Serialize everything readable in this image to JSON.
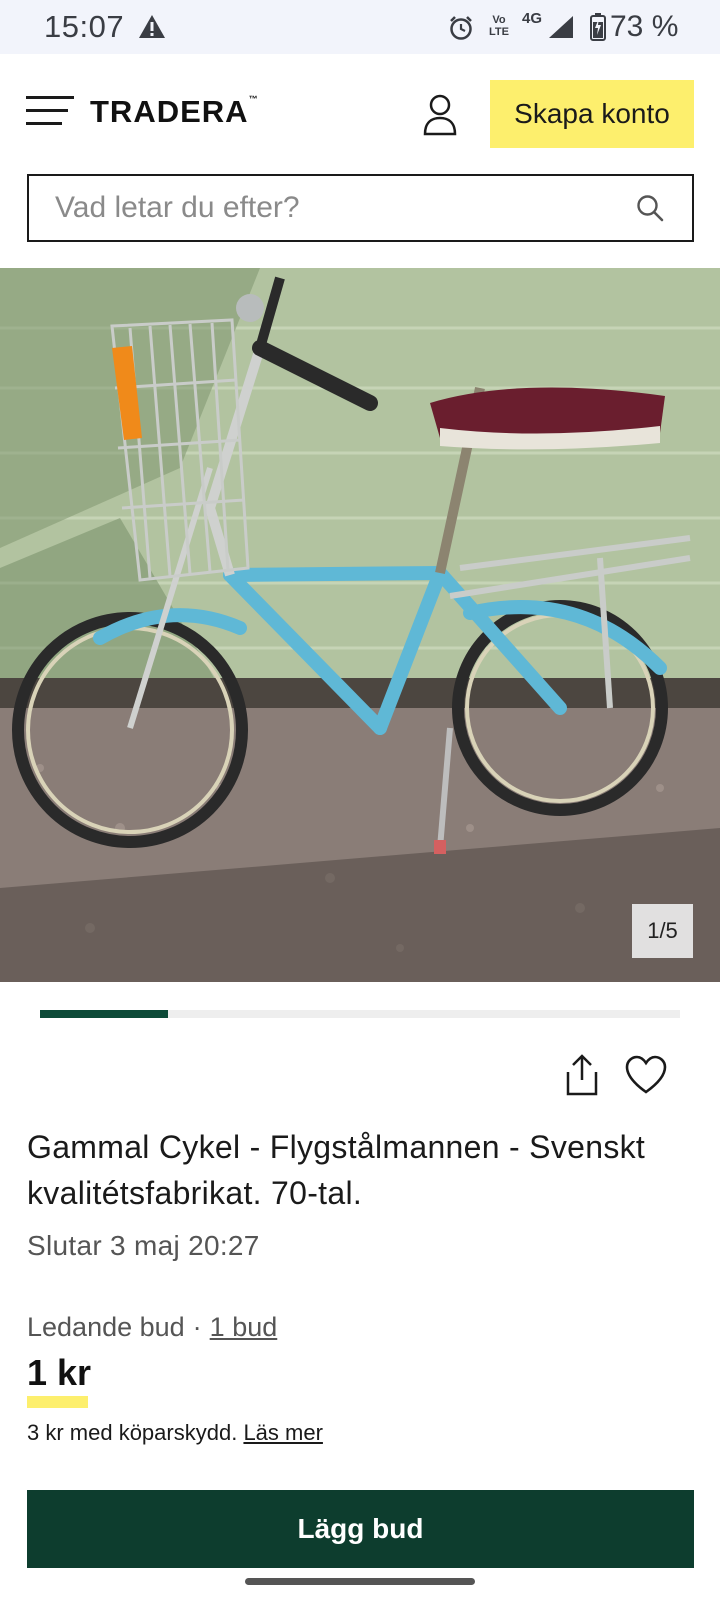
{
  "status_bar": {
    "time": "15:07",
    "network": "4G",
    "volte": "Vo LTE",
    "battery": "73 %",
    "icons": [
      "warning-icon",
      "alarm-icon",
      "volte-icon",
      "signal-icon",
      "battery-icon"
    ]
  },
  "header": {
    "logo": "TRADERA",
    "signup_label": "Skapa konto",
    "icons": [
      "menu-icon",
      "user-icon"
    ]
  },
  "search": {
    "placeholder": "Vad letar du efter?",
    "value": ""
  },
  "gallery": {
    "counter": "1/5",
    "progress": 0.2
  },
  "listing": {
    "title": "Gammal Cykel - Flygstålmannen - Svenskt kvalitétsfabrikat. 70-tal.",
    "ends": "Slutar 3 maj 20:27",
    "leading_bid_label": "Ledande bud",
    "bid_separator": "·",
    "bid_count": "1 bud",
    "price": "1 kr",
    "protection_text": "3 kr med köparskydd.",
    "read_more": "Läs mer"
  },
  "actions": {
    "bid_button": "Lägg bud",
    "icons": [
      "share-icon",
      "heart-icon"
    ]
  },
  "colors": {
    "accent_yellow": "#fdef6d",
    "brand_green": "#0d3d2e",
    "progress_green": "#0d4a38"
  }
}
